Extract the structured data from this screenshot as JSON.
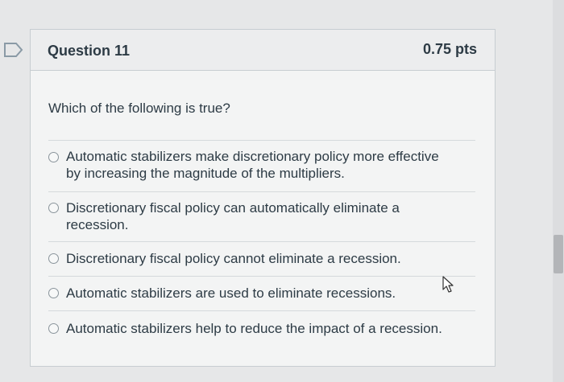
{
  "question": {
    "title": "Question 11",
    "points": "0.75 pts",
    "prompt": "Which of the following is true?",
    "answers": [
      {
        "line1": "Automatic stabilizers make discretionary policy more effective",
        "line2": "by increasing the magnitude of the multipliers.",
        "selected": false
      },
      {
        "line1": "Discretionary fiscal policy can automatically eliminate a",
        "line2": "recession.",
        "selected": false
      },
      {
        "line1": "Discretionary fiscal policy cannot eliminate a recession.",
        "line2": "",
        "selected": false
      },
      {
        "line1": "Automatic stabilizers are used to eliminate recessions.",
        "line2": "",
        "selected": false
      },
      {
        "line1": "Automatic stabilizers help to reduce the impact of a recession.",
        "line2": "",
        "selected": false
      }
    ]
  },
  "colors": {
    "accent": "#2d3b45",
    "border": "#c7cdd1",
    "flag": "#7b8c99"
  },
  "icons": {
    "flag": "flag-question-icon",
    "cursor": "mouse-pointer-icon"
  }
}
